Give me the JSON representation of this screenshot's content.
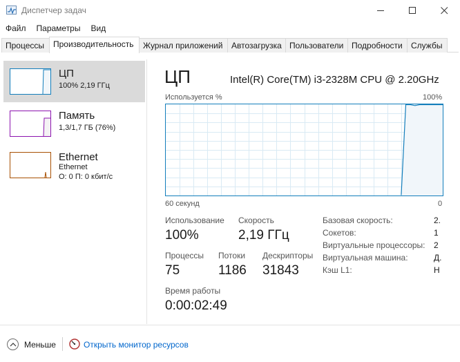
{
  "window": {
    "title": "Диспетчер задач",
    "minimize_glyph": "—",
    "maximize_glyph": "☐",
    "close_glyph": "✕"
  },
  "menu": [
    "Файл",
    "Параметры",
    "Вид"
  ],
  "tabs": [
    {
      "label": "Процессы",
      "active": false
    },
    {
      "label": "Производительность",
      "active": true
    },
    {
      "label": "Журнал приложений",
      "active": false
    },
    {
      "label": "Автозагрузка",
      "active": false
    },
    {
      "label": "Пользователи",
      "active": false
    },
    {
      "label": "Подробности",
      "active": false
    },
    {
      "label": "Службы",
      "active": false
    }
  ],
  "sidebar": {
    "items": [
      {
        "title": "ЦП",
        "line1": "100%  2,19 ГГц",
        "line2": "",
        "color": "#117dbb",
        "selected": true
      },
      {
        "title": "Память",
        "line1": "1,3/1,7 ГБ (76%)",
        "line2": "",
        "color": "#8b12ae",
        "selected": false
      },
      {
        "title": "Ethernet",
        "line1": "Ethernet",
        "line2": "О: 0 П: 0 кбит/с",
        "color": "#a74f01",
        "selected": false
      }
    ]
  },
  "cpu": {
    "title": "ЦП",
    "model": "Intel(R) Core(TM) i3-2328M CPU @ 2.20GHz",
    "graph_label_left": "Используется %",
    "graph_label_right": "100%",
    "axis_left": "60 секунд",
    "axis_right": "0",
    "graph_color": "#117dbb",
    "graph_fill": "#f1f6fa",
    "grid_color": "#d9eaf4",
    "usage_history": [
      0,
      0,
      0,
      0,
      0,
      0,
      0,
      0,
      0,
      0,
      0,
      0,
      0,
      0,
      0,
      0,
      0,
      0,
      0,
      0,
      0,
      0,
      0,
      0,
      0,
      0,
      0,
      0,
      0,
      0,
      0,
      0,
      0,
      0,
      0,
      0,
      0,
      0,
      0,
      0,
      0,
      0,
      0,
      0,
      0,
      0,
      0,
      0,
      0,
      0,
      0,
      0,
      100,
      100,
      99,
      100,
      100,
      100,
      100,
      100,
      100
    ],
    "stats": {
      "usage_label": "Использование",
      "usage_value": "100%",
      "speed_label": "Скорость",
      "speed_value": "2,19 ГГц",
      "processes_label": "Процессы",
      "processes_value": "75",
      "threads_label": "Потоки",
      "threads_value": "1186",
      "handles_label": "Дескрипторы",
      "handles_value": "31843",
      "uptime_label": "Время работы",
      "uptime_value": "0:00:02:49"
    },
    "specs": [
      {
        "label": "Базовая скорость:",
        "value": "2."
      },
      {
        "label": "Сокетов:",
        "value": "1"
      },
      {
        "label": "Виртуальные процессоры:",
        "value": "2"
      },
      {
        "label": "Виртуальная машина:",
        "value": "Д."
      },
      {
        "label": "Кэш L1:",
        "value": "Н"
      }
    ]
  },
  "footer": {
    "less_label": "Меньше",
    "monitor_link": "Открыть монитор ресурсов"
  }
}
